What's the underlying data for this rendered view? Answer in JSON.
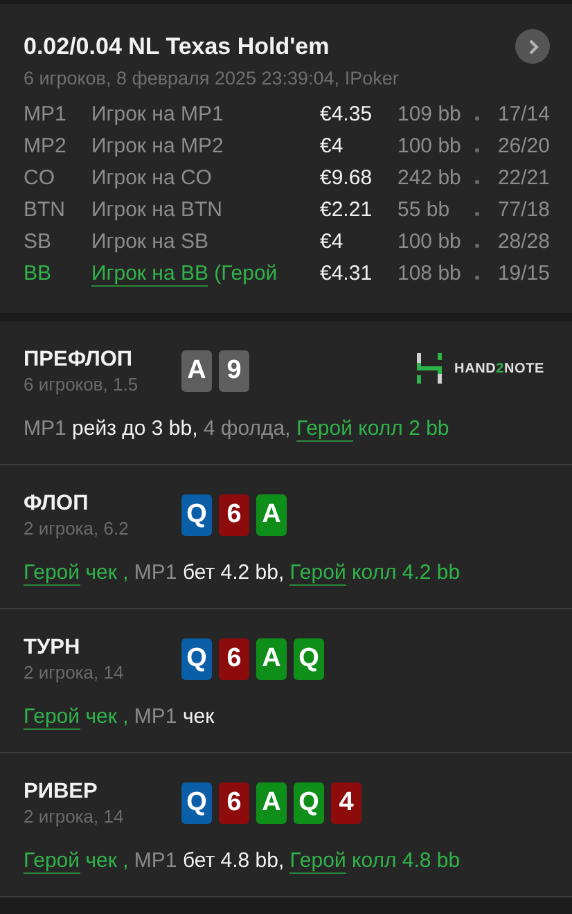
{
  "header": {
    "title": "0.02/0.04 NL Texas Hold'em",
    "subtitle": "6 игроков, 8 февраля 2025 23:39:04, IPoker"
  },
  "players": [
    {
      "position": "MP1",
      "name": "Игрок на MP1",
      "stack": "€4.35",
      "bb": "109 bb",
      "stats": "17/14",
      "hero": false
    },
    {
      "position": "MP2",
      "name": "Игрок на MP2",
      "stack": "€4",
      "bb": "100 bb",
      "stats": "26/20",
      "hero": false
    },
    {
      "position": "CO",
      "name": "Игрок на CO",
      "stack": "€9.68",
      "bb": "242 bb",
      "stats": "22/21",
      "hero": false
    },
    {
      "position": "BTN",
      "name": "Игрок на BTN",
      "stack": "€2.21",
      "bb": "55 bb",
      "stats": "77/18",
      "hero": false
    },
    {
      "position": "SB",
      "name": "Игрок на SB",
      "stack": "€4",
      "bb": "100 bb",
      "stats": "28/28",
      "hero": false
    },
    {
      "position": "BB",
      "name": "Игрок на BB",
      "tag": "(Герой",
      "stack": "€4.31",
      "bb": "108 bb",
      "stats": "19/15",
      "hero": true
    }
  ],
  "logo": {
    "before": "HAND",
    "accent": "2",
    "after": "NOTE"
  },
  "streets": [
    {
      "name": "ПРЕФЛОП",
      "subtitle": "6 игроков, 1.5",
      "logo": true,
      "cards": [
        {
          "rank": "A",
          "color": "#5e5e5e"
        },
        {
          "rank": "9",
          "color": "#5e5e5e"
        }
      ],
      "actions": [
        {
          "kind": "player",
          "text": "MP1"
        },
        {
          "kind": "action",
          "text": " рейз до 3 bb,"
        },
        {
          "kind": "player",
          "text": " 4 фолда, "
        },
        {
          "kind": "hero",
          "text": "Герой"
        },
        {
          "kind": "hero_action",
          "text": " колл 2 bb"
        }
      ]
    },
    {
      "name": "ФЛОП",
      "subtitle": "2 игрока, 6.2",
      "logo": false,
      "cards": [
        {
          "rank": "Q",
          "color": "#0b5ea8"
        },
        {
          "rank": "6",
          "color": "#8e0b0b"
        },
        {
          "rank": "A",
          "color": "#0f8f1a"
        }
      ],
      "actions": [
        {
          "kind": "hero",
          "text": "Герой"
        },
        {
          "kind": "hero_action",
          "text": " чек ,"
        },
        {
          "kind": "player",
          "text": " MP1"
        },
        {
          "kind": "action",
          "text": " бет 4.2 bb, "
        },
        {
          "kind": "hero",
          "text": "Герой"
        },
        {
          "kind": "hero_action",
          "text": " колл 4.2 bb"
        }
      ]
    },
    {
      "name": "ТУРН",
      "subtitle": "2 игрока, 14",
      "logo": false,
      "cards": [
        {
          "rank": "Q",
          "color": "#0b5ea8"
        },
        {
          "rank": "6",
          "color": "#8e0b0b"
        },
        {
          "rank": "A",
          "color": "#0f8f1a"
        },
        {
          "rank": "Q",
          "color": "#0f8f1a"
        }
      ],
      "actions": [
        {
          "kind": "hero",
          "text": "Герой"
        },
        {
          "kind": "hero_action",
          "text": " чек ,"
        },
        {
          "kind": "player",
          "text": " MP1"
        },
        {
          "kind": "action",
          "text": " чек"
        }
      ]
    },
    {
      "name": "РИВЕР",
      "subtitle": "2 игрока, 14",
      "logo": false,
      "cards": [
        {
          "rank": "Q",
          "color": "#0b5ea8"
        },
        {
          "rank": "6",
          "color": "#8e0b0b"
        },
        {
          "rank": "A",
          "color": "#0f8f1a"
        },
        {
          "rank": "Q",
          "color": "#0f8f1a"
        },
        {
          "rank": "4",
          "color": "#8e0b0b"
        }
      ],
      "actions": [
        {
          "kind": "hero",
          "text": "Герой"
        },
        {
          "kind": "hero_action",
          "text": " чек ,"
        },
        {
          "kind": "player",
          "text": " MP1"
        },
        {
          "kind": "action",
          "text": " бет 4.8 bb, "
        },
        {
          "kind": "hero",
          "text": "Герой"
        },
        {
          "kind": "hero_action",
          "text": " колл 4.8 bb"
        }
      ]
    }
  ]
}
